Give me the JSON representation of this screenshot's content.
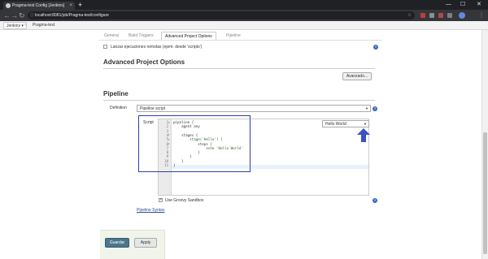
{
  "browser": {
    "tab_title": "Pragma-test Config [Jenkins]",
    "tab_close": "×",
    "new_tab": "+",
    "url": "localhost:8081/job/Pragma-test/configure",
    "win_minimize": "—",
    "win_maximize": "☐",
    "win_close": "✕"
  },
  "breadcrumb": {
    "root": "Jenkins",
    "separator": "›",
    "job": "Pragma-test"
  },
  "config_tabs": [
    "General",
    "Build Triggers",
    "Advanced Project Options",
    "Pipeline"
  ],
  "remote_trigger": {
    "label": "Lanzar ejecuciones remotas (ejem: desde 'scripts')",
    "checked": false
  },
  "advanced_section": {
    "title": "Advanced Project Options",
    "advanced_button": "Avanzado..."
  },
  "pipeline_section": {
    "title": "Pipeline",
    "definition_label": "Definition",
    "definition_value": "Pipeline script",
    "script_label": "Script",
    "line_numbers": [
      "1",
      "2",
      "3",
      "4",
      "5",
      "6",
      "7",
      "8",
      "9",
      "10",
      "11"
    ],
    "code_lines": [
      "pipeline {",
      "    agent any",
      "",
      "    stages {",
      "        stage('Hello') {",
      "            steps {",
      "                echo 'Hello World'",
      "            }",
      "        }",
      "    }",
      "}"
    ],
    "sample_select": "Hello World",
    "groovy_sandbox_label": "Use Groovy Sandbox",
    "groovy_sandbox_checked": true,
    "syntax_link": "Pipeline Syntax"
  },
  "actions": {
    "save": "Guardar",
    "apply": "Apply"
  },
  "colors": {
    "annotation_box": "#2f3fa8",
    "annotation_arrow": "#3a4fc8",
    "save_button": "#4b758b"
  }
}
